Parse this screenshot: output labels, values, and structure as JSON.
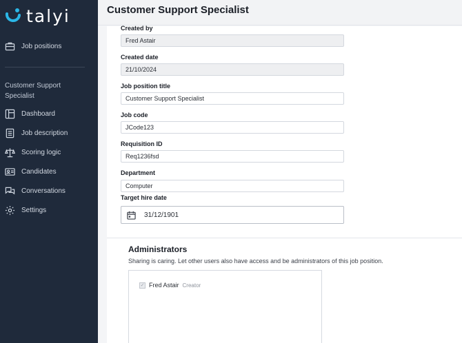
{
  "app": {
    "name": "talyi"
  },
  "sidebar": {
    "top_items": [
      {
        "label": "Job positions",
        "icon": "briefcase-icon"
      }
    ],
    "section_title": "Customer Support Specialist",
    "items": [
      {
        "label": "Dashboard",
        "icon": "dashboard-icon"
      },
      {
        "label": "Job description",
        "icon": "document-icon"
      },
      {
        "label": "Scoring logic",
        "icon": "scale-icon"
      },
      {
        "label": "Candidates",
        "icon": "id-card-icon"
      },
      {
        "label": "Conversations",
        "icon": "chat-icon"
      },
      {
        "label": "Settings",
        "icon": "gear-icon"
      }
    ]
  },
  "header": {
    "title": "Customer Support Specialist"
  },
  "form": {
    "created_by": {
      "label": "Created by",
      "value": "Fred Astair"
    },
    "created_date": {
      "label": "Created date",
      "value": "21/10/2024"
    },
    "job_title": {
      "label": "Job position title",
      "value": "Customer Support Specialist"
    },
    "job_code": {
      "label": "Job code",
      "value": "JCode123"
    },
    "requisition_id": {
      "label": "Requisition ID",
      "value": "Req1236fsd"
    },
    "department": {
      "label": "Department",
      "value": "Computer"
    },
    "target_hire_date": {
      "label": "Target hire date",
      "value": "31/12/1901",
      "icon": "calendar-icon"
    }
  },
  "administrators": {
    "title": "Administrators",
    "description": "Sharing is caring. Let other users also have access and be administrators of this job position.",
    "list": [
      {
        "name": "Fred Astair",
        "role": "Creator",
        "checked": true
      }
    ]
  },
  "colors": {
    "sidebar_bg": "#1f2a3b",
    "logo_accent": "#2bb6e6"
  }
}
